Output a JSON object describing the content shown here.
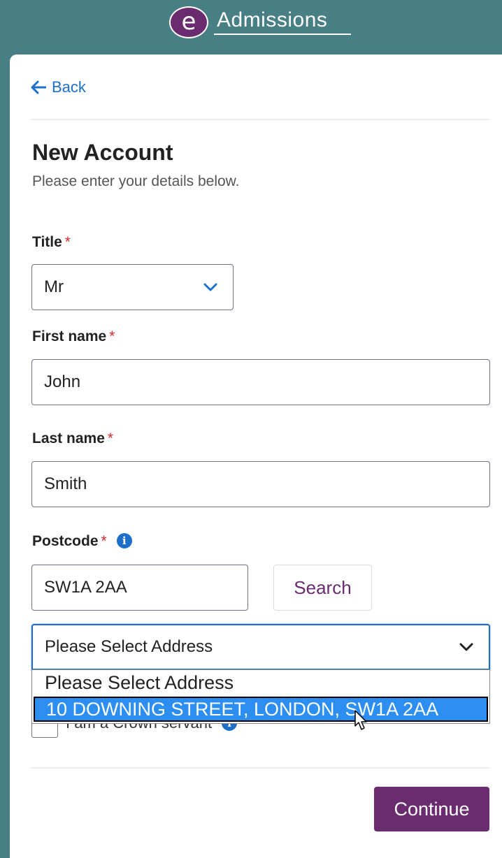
{
  "brand": {
    "logo_letter": "e",
    "name": "Admissions"
  },
  "nav": {
    "back_label": "Back"
  },
  "page": {
    "title": "New Account",
    "subtitle": "Please enter your details below."
  },
  "form": {
    "required_marker": "*",
    "title": {
      "label": "Title",
      "value": "Mr"
    },
    "first_name": {
      "label": "First name",
      "value": "John"
    },
    "last_name": {
      "label": "Last name",
      "value": "Smith"
    },
    "postcode": {
      "label": "Postcode",
      "value": "SW1A 2AA",
      "search_label": "Search"
    },
    "address": {
      "value": "Please Select Address",
      "options": [
        "Please Select Address",
        "10 DOWNING STREET, LONDON, SW1A 2AA"
      ],
      "highlighted_option": "10 DOWNING STREET, LONDON, SW1A 2AA"
    },
    "crown_servant": {
      "label": "I am a Crown servant",
      "checked": false
    }
  },
  "actions": {
    "continue_label": "Continue"
  },
  "colors": {
    "brand_purple": "#6a2c6f",
    "header_teal": "#477f85",
    "link_blue": "#1d6fc9",
    "required_red": "#d9262e"
  }
}
